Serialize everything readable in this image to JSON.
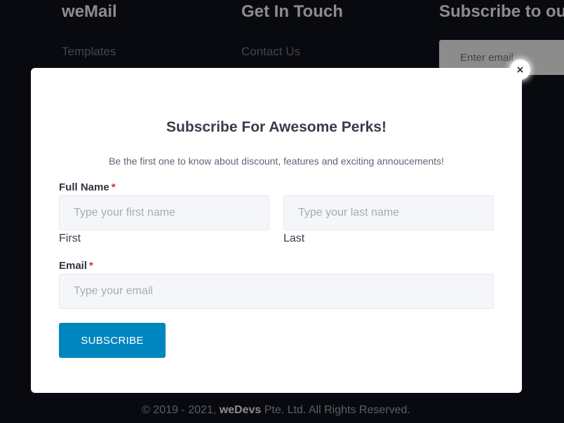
{
  "footer": {
    "columns": [
      {
        "heading": "weMail",
        "link": "Templates"
      },
      {
        "heading": "Get In Touch",
        "link": "Contact Us"
      },
      {
        "heading": "Subscribe to ou"
      }
    ],
    "email_placeholder": "Enter email",
    "copyright": {
      "prefix": "© 2019 - 2021, ",
      "brand": "weDevs",
      "suffix": " Pte. Ltd. All Rights Reserved."
    }
  },
  "modal": {
    "close_icon": "×",
    "title": "Subscribe For Awesome Perks!",
    "subtitle": "Be the first one to know about discount, features and exciting annoucements!",
    "full_name": {
      "label": "Full Name",
      "required_mark": "*",
      "first_placeholder": "Type your first name",
      "last_placeholder": "Type your last name",
      "first_sublabel": "First",
      "last_sublabel": "Last"
    },
    "email": {
      "label": "Email",
      "required_mark": "*",
      "placeholder": "Type your email"
    },
    "submit_label": "SUBSCRIBE"
  },
  "colors": {
    "background": "#11131c",
    "button": "#0086bf",
    "required": "#e02b2b",
    "input_bg": "#f5f6fa"
  }
}
